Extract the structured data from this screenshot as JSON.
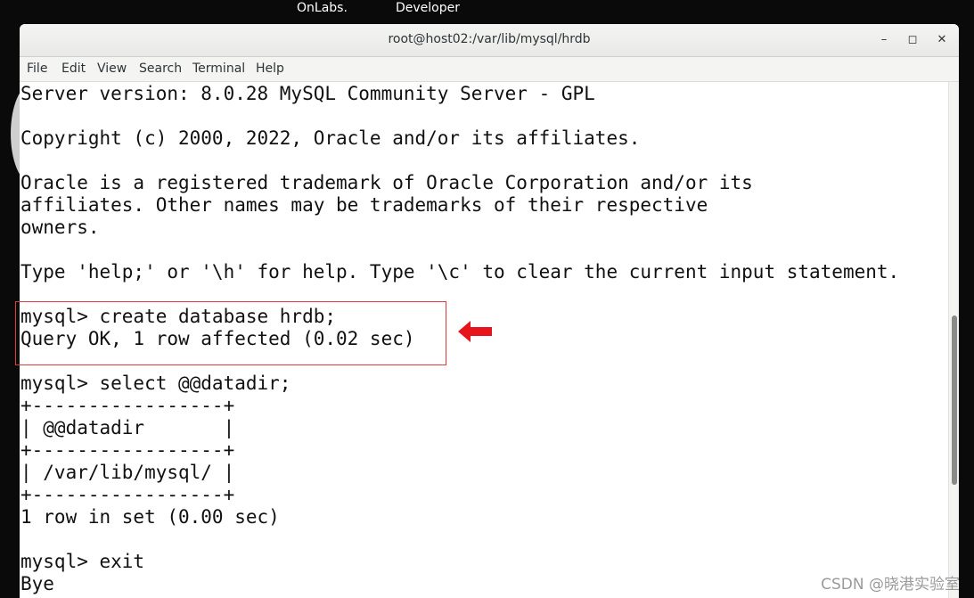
{
  "desktop": {
    "label_left": "OnLabs.",
    "label_right": "Developer"
  },
  "window": {
    "title": "root@host02:/var/lib/mysql/hrdb",
    "minimize_symbol": "–",
    "maximize_symbol": "◻",
    "close_symbol": "✕"
  },
  "menu": {
    "items": [
      "File",
      "Edit",
      "View",
      "Search",
      "Terminal",
      "Help"
    ]
  },
  "terminal": {
    "lines": [
      "Server version: 8.0.28 MySQL Community Server - GPL",
      "",
      "Copyright (c) 2000, 2022, Oracle and/or its affiliates.",
      "",
      "Oracle is a registered trademark of Oracle Corporation and/or its",
      "affiliates. Other names may be trademarks of their respective",
      "owners.",
      "",
      "Type 'help;' or '\\h' for help. Type '\\c' to clear the current input statement.",
      "",
      "mysql> create database hrdb;",
      "Query OK, 1 row affected (0.02 sec)",
      "",
      "mysql> select @@datadir;",
      "+-----------------+",
      "| @@datadir       |",
      "+-----------------+",
      "| /var/lib/mysql/ |",
      "+-----------------+",
      "1 row in set (0.00 sec)",
      "",
      "mysql> exit",
      "Bye"
    ]
  },
  "annotation": {
    "box_color": "#e23a3a",
    "arrow_color": "#e8141c"
  },
  "watermark": {
    "text": "CSDN @晓港实验室"
  },
  "icons": {
    "minimize": "minimize-icon",
    "maximize": "maximize-icon",
    "close": "close-icon",
    "arrow": "left-arrow-icon"
  }
}
